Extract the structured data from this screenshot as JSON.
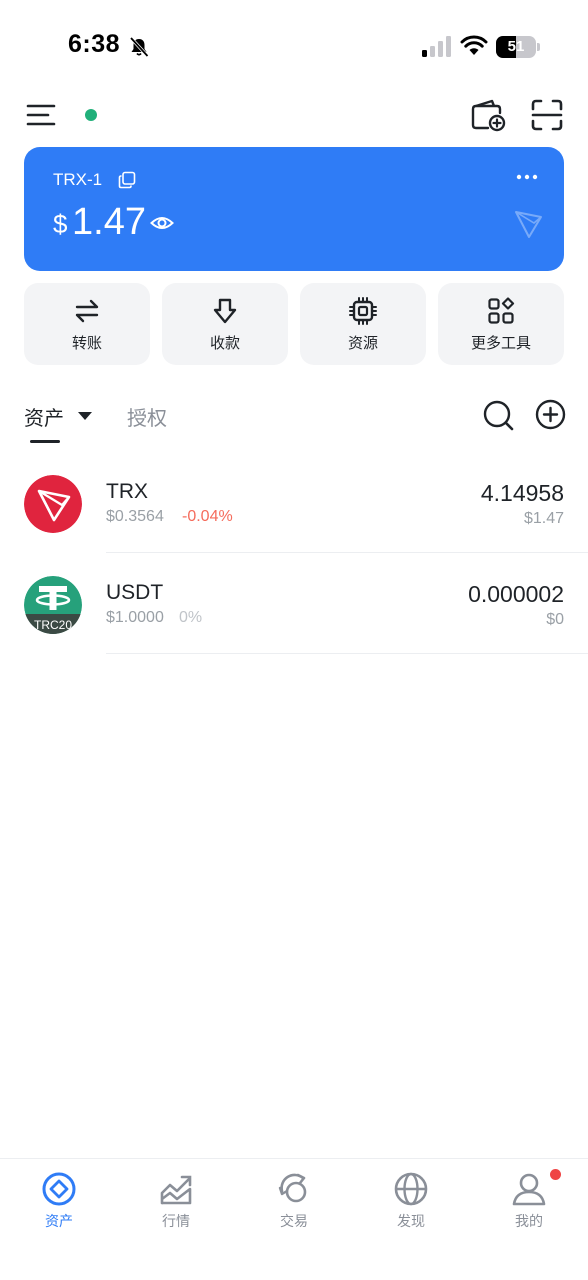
{
  "status_bar": {
    "time": "6:38",
    "battery_level": "51",
    "battery_fraction": 0.51
  },
  "icons": {
    "menu": "menu-icon",
    "add_wallet": "wallet-add-icon",
    "scan": "scan-icon",
    "copy": "copy-icon",
    "eye": "eye-icon",
    "search": "search-icon",
    "add": "plus-circle-icon"
  },
  "colors": {
    "accent": "#2f7cf6",
    "online": "#21b07a",
    "negative": "#f56c5c",
    "muted": "#9aa0a6",
    "trx_brand": "#e0243e",
    "usdt_brand": "#26a17b"
  },
  "wallet": {
    "name": "TRX-1",
    "currency_symbol": "$",
    "balance": "1.47"
  },
  "actions": [
    {
      "label": "转账",
      "icon": "transfer-icon"
    },
    {
      "label": "收款",
      "icon": "receive-icon"
    },
    {
      "label": "资源",
      "icon": "chip-icon"
    },
    {
      "label": "更多工具",
      "icon": "grid-icon"
    }
  ],
  "tabs": {
    "assets": "资产",
    "approvals": "授权"
  },
  "tokens": [
    {
      "symbol": "TRX",
      "price": "$0.3564",
      "change": "-0.04%",
      "amount": "4.14958",
      "fiat": "$1.47"
    },
    {
      "symbol": "USDT",
      "badge": "TRC20",
      "price": "$1.0000",
      "change": "0%",
      "amount": "0.000002",
      "fiat": "$0"
    }
  ],
  "bottom_nav": [
    {
      "label": "资产",
      "icon": "assets-icon",
      "active": true
    },
    {
      "label": "行情",
      "icon": "market-icon",
      "active": false
    },
    {
      "label": "交易",
      "icon": "trade-icon",
      "active": false
    },
    {
      "label": "发现",
      "icon": "discover-icon",
      "active": false
    },
    {
      "label": "我的",
      "icon": "profile-icon",
      "active": false
    }
  ]
}
